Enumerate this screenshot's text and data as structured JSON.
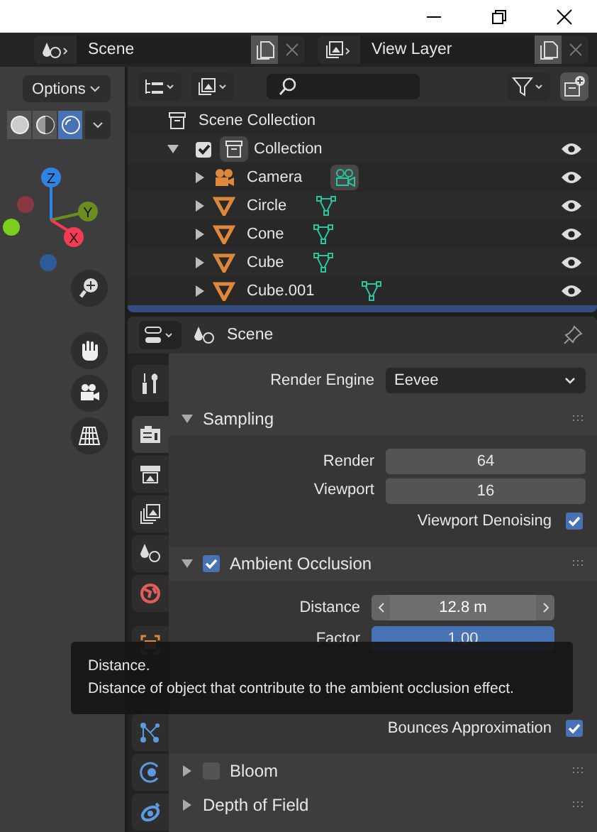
{
  "top_bar": {
    "scene": {
      "value": "Scene"
    },
    "view_layer": {
      "value": "View Layer"
    }
  },
  "viewport": {
    "options": "Options",
    "shading_modes": [
      {
        "kind": "solid",
        "selected": false
      },
      {
        "kind": "material",
        "selected": false
      },
      {
        "kind": "rendered",
        "selected": true
      }
    ],
    "gizmo_axes": [
      {
        "label": "Z",
        "color": "#2f84e3"
      },
      {
        "label": "Y",
        "color": "#6b8c21"
      },
      {
        "label": "X",
        "color": "#f53a55"
      }
    ]
  },
  "outliner": {
    "root": "Scene Collection",
    "collection": {
      "label": "Collection",
      "checked": true,
      "expanded": true,
      "children": [
        {
          "label": "Camera",
          "kind": "camera"
        },
        {
          "label": "Circle",
          "kind": "mesh"
        },
        {
          "label": "Cone",
          "kind": "mesh"
        },
        {
          "label": "Cube",
          "kind": "mesh"
        },
        {
          "label": "Cube.001",
          "kind": "mesh"
        }
      ]
    }
  },
  "properties": {
    "title": "Scene",
    "tabs": [
      {
        "kind": "tool",
        "selected": false
      },
      {
        "kind": "render",
        "selected": true
      },
      {
        "kind": "output",
        "selected": false
      },
      {
        "kind": "view_layer",
        "selected": false
      },
      {
        "kind": "scene",
        "selected": false
      },
      {
        "kind": "world",
        "selected": false
      },
      {
        "kind": "object",
        "selected": false
      },
      {
        "kind": "particles",
        "selected": false
      },
      {
        "kind": "physics",
        "selected": false
      },
      {
        "kind": "constraints",
        "selected": false
      }
    ],
    "render_engine": {
      "label": "Render Engine",
      "value": "Eevee"
    },
    "panels": [
      {
        "title": "Sampling",
        "expanded": true,
        "rows": [
          {
            "kind": "number",
            "label": "Render",
            "value": "64"
          },
          {
            "kind": "number",
            "label": "Viewport",
            "value": "16"
          },
          {
            "kind": "check",
            "label": "Viewport Denoising",
            "checked": true
          }
        ]
      },
      {
        "title": "Ambient Occlusion",
        "expanded": true,
        "checked": true,
        "rows": [
          {
            "kind": "stepper",
            "label": "Distance",
            "value": "12.8 m"
          },
          {
            "kind": "factor",
            "label": "Factor",
            "value": "1.00",
            "level": 1
          },
          {
            "kind": "hidden"
          },
          {
            "kind": "hidden"
          },
          {
            "kind": "check",
            "label": "Bounces Approximation",
            "checked": true
          }
        ]
      },
      {
        "title": "Bloom",
        "expanded": false,
        "checked": false
      },
      {
        "title": "Depth of Field",
        "expanded": false
      }
    ]
  },
  "tooltip": {
    "title": "Distance.",
    "text": "Distance of object that contribute to the ambient occlusion effect."
  }
}
